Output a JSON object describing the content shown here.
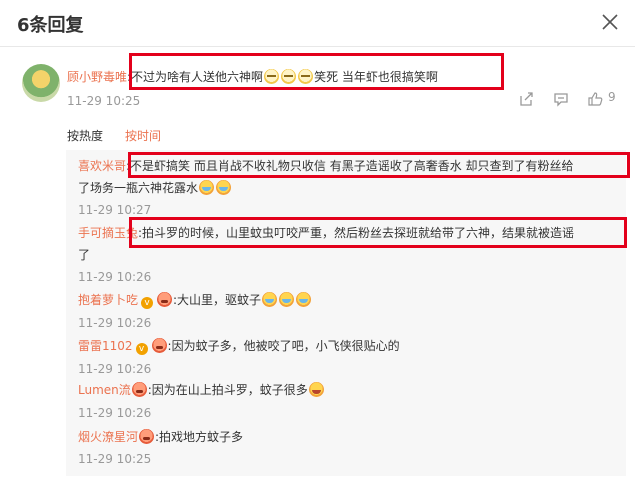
{
  "header": {
    "title": "6条回复",
    "close_icon": "close-icon"
  },
  "main_comment": {
    "username": "顾小野毒唯",
    "text_a": ":不过为啥有人送他六神啊",
    "text_b": "笑死 当年虾也很搞笑啊",
    "time": "11-29 10:25",
    "like_count": "9"
  },
  "sort": {
    "hot": "按热度",
    "time": "按时间"
  },
  "replies": [
    {
      "user": "喜欢米哥",
      "text": ":不是虾搞笑 而且肖战不收礼物只收信 有黑子造谣收了高奢香水 却只查到了有粉丝给",
      "text2": "了场务一瓶六神花露水",
      "time": "11-29 10:27"
    },
    {
      "user": "手可摘玉兔",
      "text": ":拍斗罗的时候，山里蚊虫叮咬严重，然后粉丝去探班就给带了六神，结果就被造谣",
      "text2": "了",
      "time": "11-29 10:26"
    },
    {
      "user": "抱着萝卜吃",
      "text": ":大山里，驱蚊子",
      "time": "11-29 10:26"
    },
    {
      "user": "雷雷1102",
      "text": ":因为蚊子多，他被咬了吧，小飞侠很贴心的",
      "time": "11-29 10:26"
    },
    {
      "user": "Lumen流",
      "text": ":因为在山上拍斗罗，蚊子很多",
      "time": "11-29 10:26"
    },
    {
      "user": "烟火潦星河",
      "text": ":拍戏地方蚊子多",
      "time": "11-29 10:25"
    }
  ],
  "colors": {
    "accent": "#eb7350",
    "highlight_box": "#e3001b",
    "reply_bg": "#f7f7f7"
  }
}
